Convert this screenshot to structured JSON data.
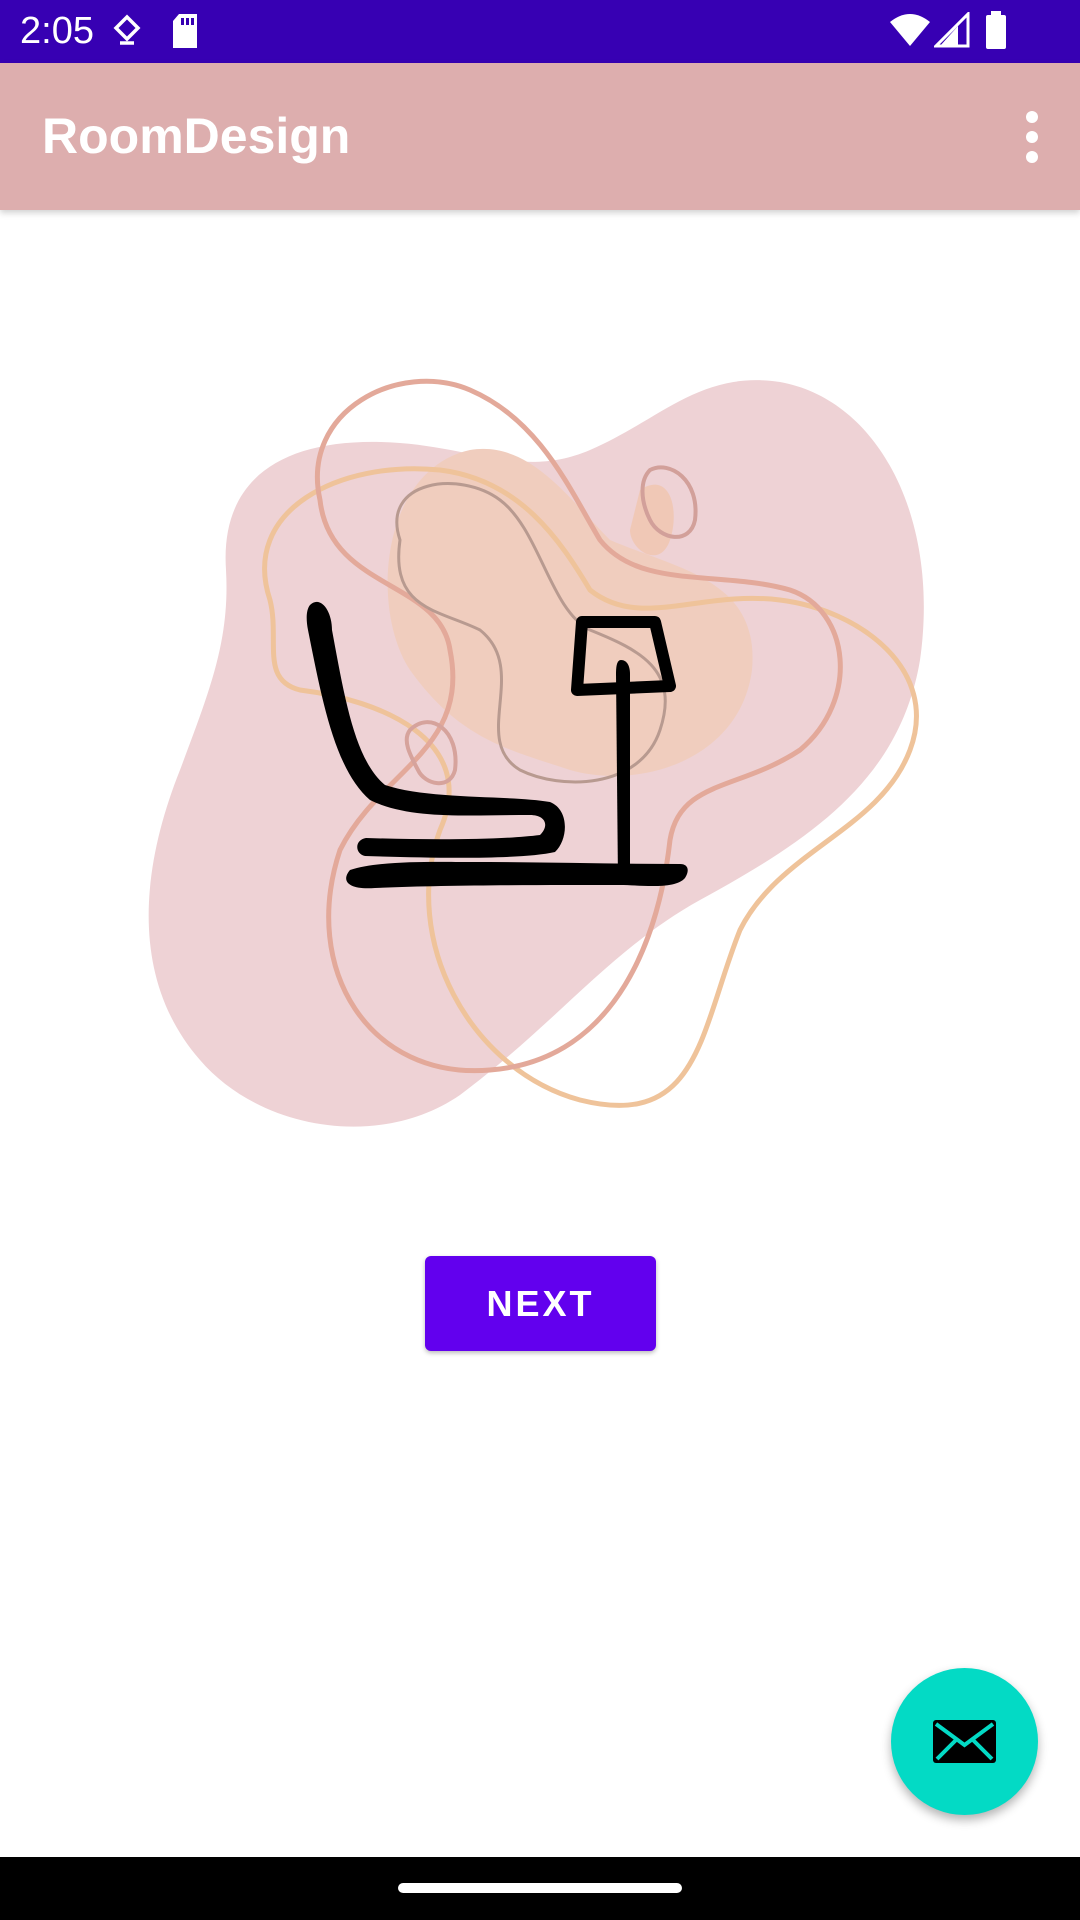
{
  "status_bar": {
    "time": "2:05",
    "icons": [
      "data-saver-icon",
      "sd-card-icon",
      "wifi-icon",
      "signal-icon",
      "battery-icon"
    ],
    "background": "#3700b3"
  },
  "app_bar": {
    "title": "RoomDesign",
    "overflow_icon": "more-vert-icon",
    "background": "#ddaeae"
  },
  "illustration": {
    "icon": "chair-and-lamp-illustration"
  },
  "next_button": {
    "label": "NEXT",
    "background": "#6200ee"
  },
  "fab": {
    "icon": "email-icon",
    "background": "#03dac5"
  },
  "nav_bar": {
    "background": "#000000"
  }
}
